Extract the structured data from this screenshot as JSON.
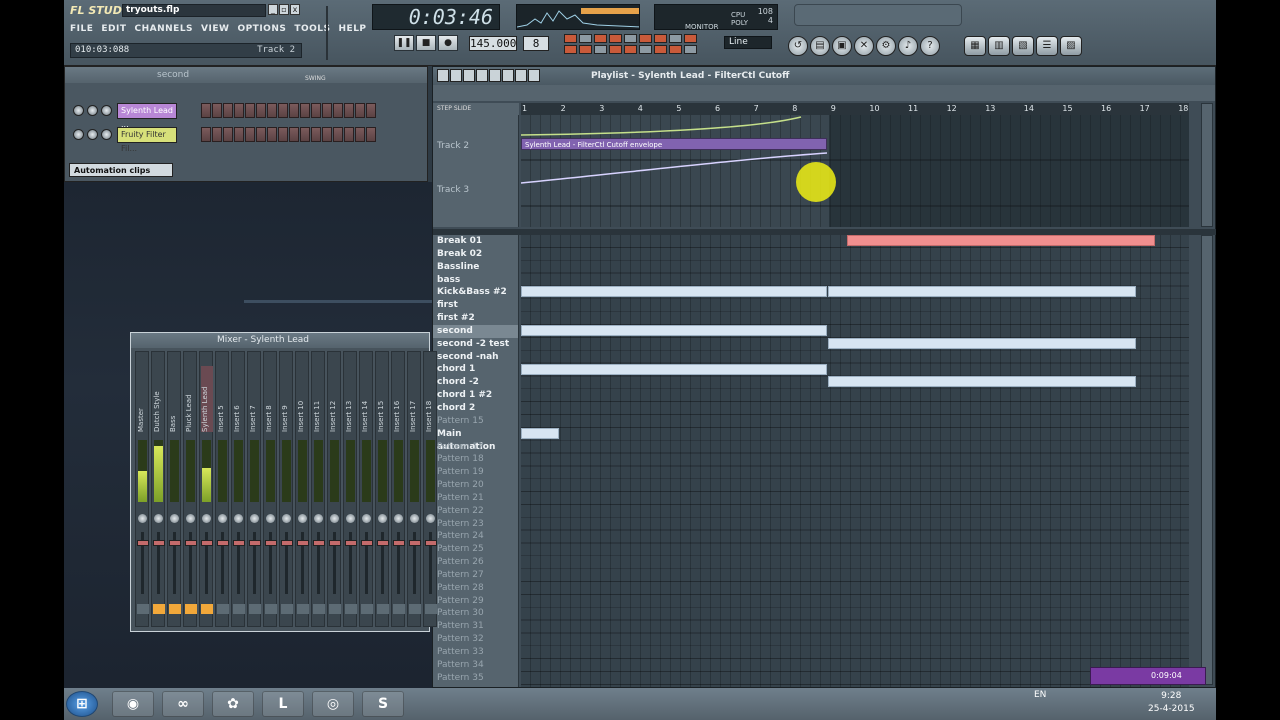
{
  "app": {
    "logo": "FL STUDIO",
    "file": "tryouts.flp",
    "window_buttons": [
      "_",
      "▫",
      "x"
    ]
  },
  "menu": [
    "FILE",
    "EDIT",
    "CHANNELS",
    "VIEW",
    "OPTIONS",
    "TOOLS",
    "HELP"
  ],
  "hint": {
    "time": "010:03:088",
    "track": "Track 2"
  },
  "time_display": "0:03:46",
  "tempo": "145.000",
  "snap": "8",
  "meters": {
    "values": [
      "108",
      "4"
    ],
    "labels": [
      "CPU",
      "POLY",
      "MONITOR"
    ]
  },
  "line_mode": "Line",
  "transport": {
    "pause": "❚❚",
    "stop": "■",
    "record": "●"
  },
  "channel_rack": {
    "title": "second",
    "swing": "SWING",
    "channels": [
      {
        "name": "Sylenth Lead ...",
        "color": "#b887d6"
      },
      {
        "name": "Fruity Filter Fil...",
        "color": "#d7e07a"
      }
    ],
    "filter": "Automation clips"
  },
  "playlist": {
    "title": "Playlist - Sylenth Lead - FilterCtl Cutoff",
    "step": "STEP",
    "slide": "SLIDE",
    "ruler": [
      "1",
      "2",
      "3",
      "4",
      "5",
      "6",
      "7",
      "8",
      "9",
      "10",
      "11",
      "12",
      "13",
      "14",
      "15",
      "16",
      "17",
      "18"
    ],
    "tracks": [
      "Track 2",
      "Track 3"
    ],
    "clip": "Sylenth Lead - FilterCtl Cutoff envelope",
    "patterns": [
      "Break 01",
      "Break 02",
      "Bassline",
      "bass",
      "Kick&Bass #2",
      "first",
      "first #2",
      "second",
      "second -2 test",
      "second -nah",
      "chord 1",
      "chord -2",
      "chord 1 #2",
      "chord 2",
      "Pattern 15",
      "Main automation",
      "Pattern 17",
      "Pattern 18",
      "Pattern 19",
      "Pattern 20",
      "Pattern 21",
      "Pattern 22",
      "Pattern 23",
      "Pattern 24",
      "Pattern 25",
      "Pattern 26",
      "Pattern 27",
      "Pattern 28",
      "Pattern 29",
      "Pattern 30",
      "Pattern 31",
      "Pattern 32",
      "Pattern 33",
      "Pattern 34",
      "Pattern 35"
    ]
  },
  "mixer": {
    "title": "Mixer - Sylenth Lead",
    "strips": [
      "Master",
      "Dutch Style",
      "Bass",
      "Pluck Lead",
      "Sylenth Lead",
      "Insert 5",
      "Insert 6",
      "Insert 7",
      "Insert 8",
      "Insert 9",
      "Insert 10",
      "Insert 11",
      "Insert 12",
      "Insert 13",
      "Insert 14",
      "Insert 15",
      "Insert 16",
      "Insert 17",
      "Insert 18"
    ]
  },
  "recorder": "0:09:04",
  "taskbar": {
    "lang": "EN",
    "time": "9:28",
    "date": "25-4-2015",
    "apps": [
      "start",
      "firefox",
      "visual-studio",
      "fl-studio",
      "lol",
      "chrome",
      "skype"
    ]
  }
}
